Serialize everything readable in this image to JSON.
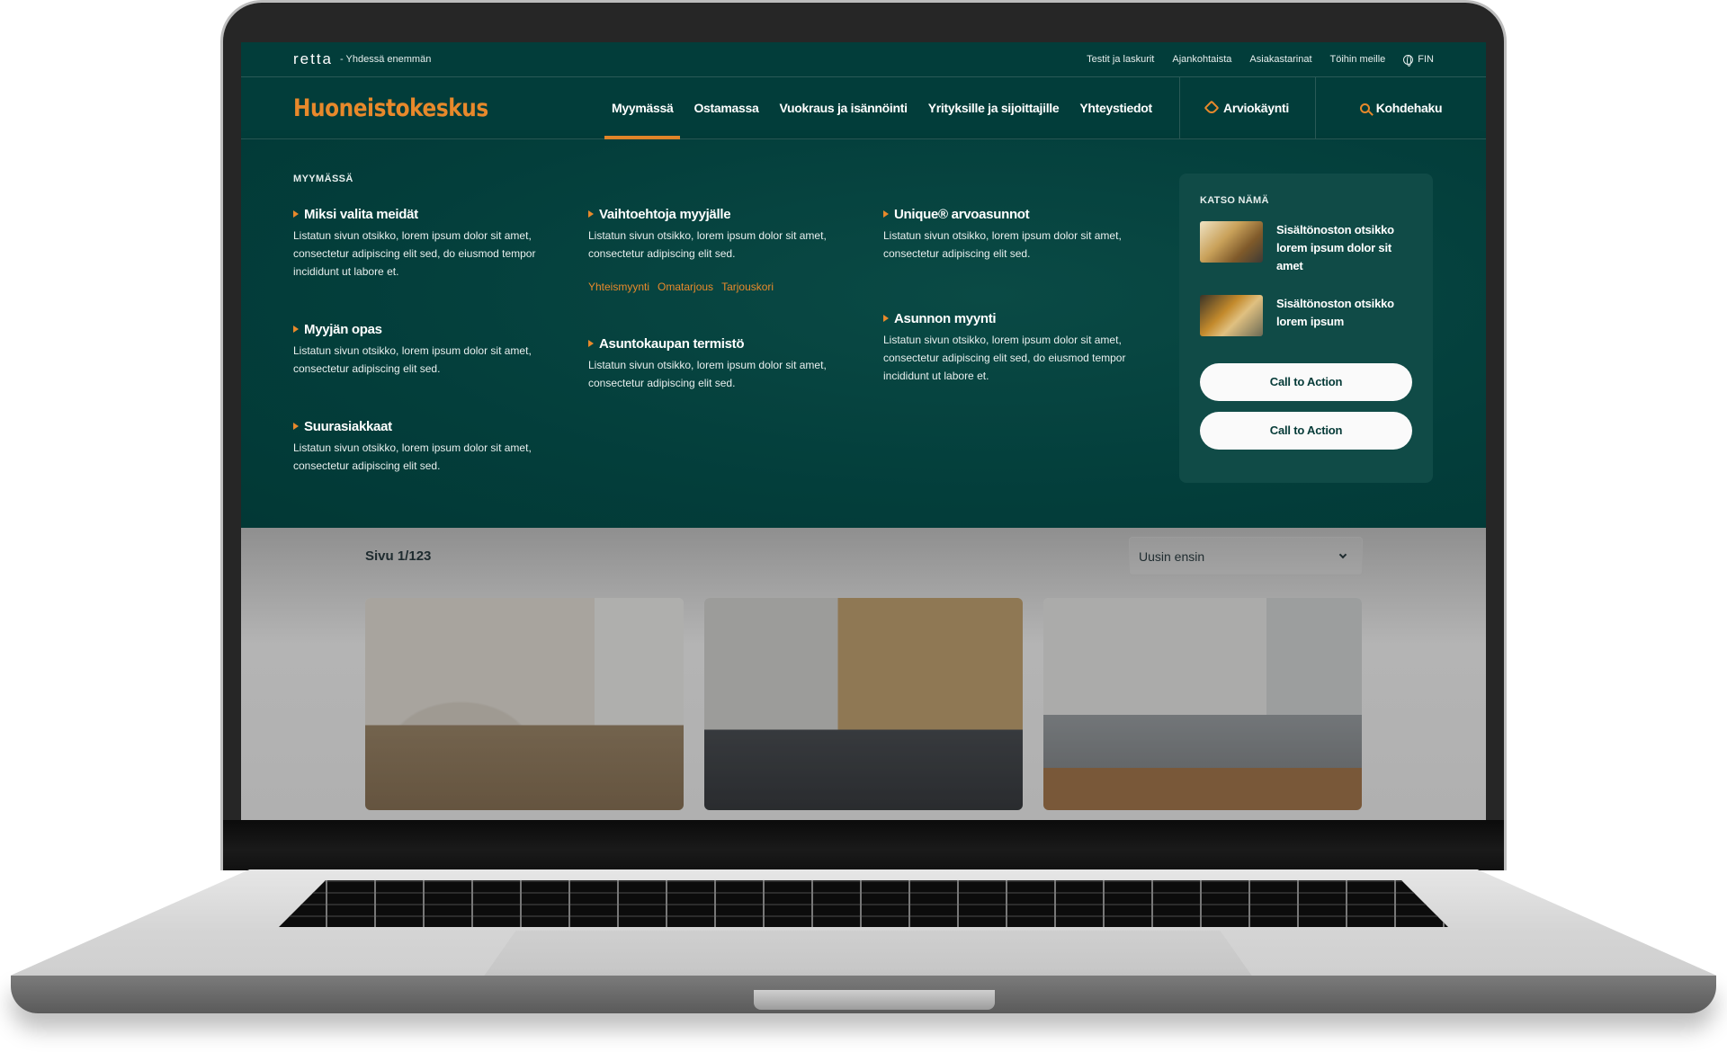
{
  "topbar": {
    "brand_logo": "retta",
    "tagline": "- Yhdessä enemmän",
    "links": [
      "Testit ja laskurit",
      "Ajankohtaista",
      "Asiakastarinat",
      "Töihin meille"
    ],
    "language": "FIN",
    "language_icon": "globe-icon"
  },
  "navbar": {
    "logo": "Huoneistokeskus",
    "items": [
      {
        "label": "Myymässä",
        "active": true
      },
      {
        "label": "Ostamassa",
        "active": false
      },
      {
        "label": "Vuokraus ja isännöinti",
        "active": false
      },
      {
        "label": "Yrityksille ja sijoittajille",
        "active": false
      },
      {
        "label": "Yhteystiedot",
        "active": false
      }
    ],
    "actions": [
      {
        "label": "Arviokäynti",
        "icon": "tag-icon"
      },
      {
        "label": "Kohdehaku",
        "icon": "search-icon"
      }
    ]
  },
  "mega_menu": {
    "heading": "MYYMÄSSÄ",
    "columns": [
      [
        {
          "title": "Miksi valita meidät",
          "desc": "Listatun sivun otsikko, lorem ipsum dolor sit amet, consectetur adipiscing elit sed, do eiusmod tempor incididunt ut labore et."
        },
        {
          "title": "Myyjän opas",
          "desc": "Listatun sivun otsikko, lorem ipsum dolor sit amet, consectetur adipiscing elit sed."
        },
        {
          "title": "Suurasiakkaat",
          "desc": "Listatun sivun otsikko, lorem ipsum dolor sit amet, consectetur adipiscing elit sed."
        }
      ],
      [
        {
          "title": "Vaihtoehtoja myyjälle",
          "desc": "Listatun sivun otsikko, lorem ipsum dolor sit amet, consectetur adipiscing elit sed.",
          "sublinks": [
            "Yhteismyynti",
            "Omatarjous",
            "Tarjouskori"
          ]
        },
        {
          "title": "Asuntokaupan termistö",
          "desc": "Listatun sivun otsikko, lorem ipsum dolor sit amet, consectetur adipiscing elit sed."
        }
      ],
      [
        {
          "title": "Unique® arvoasunnot",
          "desc": "Listatun sivun otsikko, lorem ipsum dolor sit amet, consectetur adipiscing elit sed."
        },
        {
          "title": "Asunnon myynti",
          "desc": "Listatun sivun otsikko, lorem ipsum dolor sit amet, consectetur adipiscing elit sed, do eiusmod tempor incididunt ut labore et."
        }
      ]
    ],
    "panel": {
      "title": "KATSO NÄMÄ",
      "teasers": [
        {
          "text": "Sisältönoston otsikko lorem ipsum dolor sit amet"
        },
        {
          "text": "Sisältönoston otsikko lorem ipsum"
        }
      ],
      "cta_buttons": [
        "Call to Action",
        "Call to Action"
      ]
    }
  },
  "listing": {
    "page_count": "Sivu 1/123",
    "sort": {
      "selected": "Uusin ensin"
    },
    "cards": [
      {
        "image": "living-room-photo"
      },
      {
        "image": "bedroom-photo"
      },
      {
        "image": "corner-sofa-photo"
      }
    ]
  },
  "colors": {
    "brand_dark_green": "#023d3a",
    "accent_orange": "#e8892b",
    "panel_green": "#104b47"
  }
}
